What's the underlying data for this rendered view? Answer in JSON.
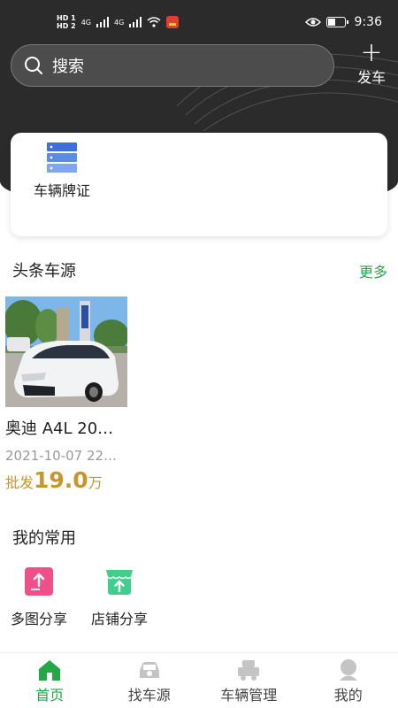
{
  "status_bar": {
    "hd_top": "HD 1",
    "hd_bottom": "HD 2",
    "net1": "4G",
    "net2": "4G",
    "time": "9:36"
  },
  "header": {
    "search_label": "搜索",
    "publish_label": "发车"
  },
  "services": [
    {
      "label": "车辆牌证"
    }
  ],
  "headline": {
    "title": "头条车源",
    "more_label": "更多",
    "listings": [
      {
        "title": "奥迪 A4L 20…",
        "date": "2021-10-07 22…",
        "price_prefix": "批发",
        "price": "19.0",
        "price_unit": "万"
      }
    ]
  },
  "favorites": {
    "title": "我的常用",
    "items": [
      {
        "label": "多图分享"
      },
      {
        "label": "店铺分享"
      }
    ]
  },
  "tabbar": {
    "items": [
      {
        "label": "首页",
        "active": true
      },
      {
        "label": "找车源"
      },
      {
        "label": "车辆管理"
      },
      {
        "label": "我的"
      }
    ]
  },
  "colors": {
    "accent": "#22a845",
    "price": "#c9952b",
    "header_bg": "#2b2b2b"
  }
}
